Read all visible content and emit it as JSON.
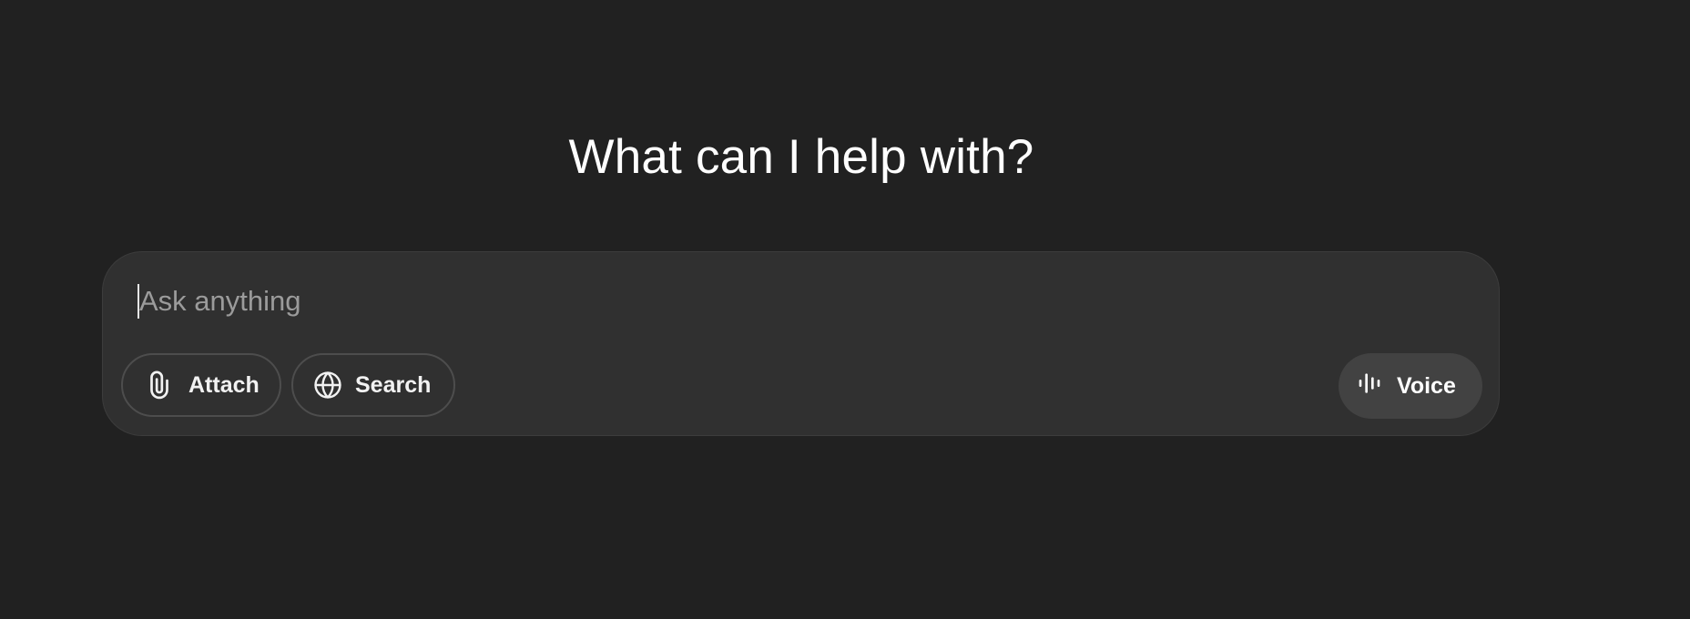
{
  "heading": "What can I help with?",
  "composer": {
    "placeholder": "Ask anything",
    "value": ""
  },
  "tools": {
    "attach": {
      "label": "Attach",
      "icon": "paperclip-icon"
    },
    "search": {
      "label": "Search",
      "icon": "globe-icon"
    }
  },
  "voice": {
    "label": "Voice",
    "icon": "audio-waveform-icon"
  },
  "colors": {
    "background": "#212121",
    "composer": "#303030",
    "voice_button": "#424242",
    "text": "#ffffff",
    "placeholder": "#9b9b9b"
  }
}
